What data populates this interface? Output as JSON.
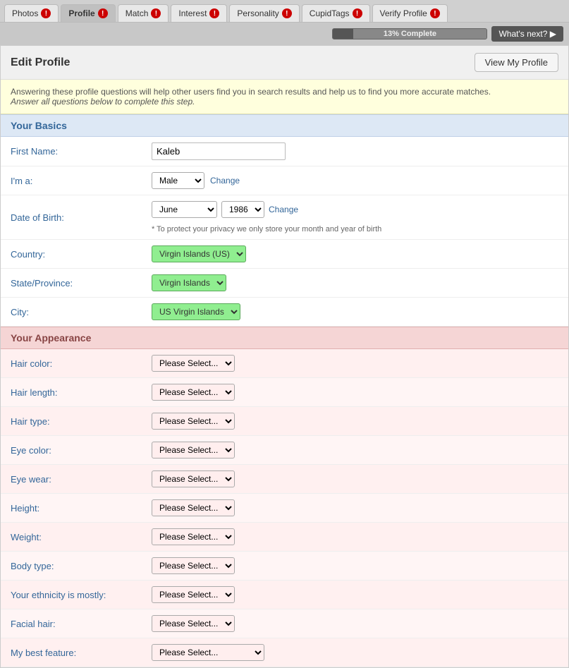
{
  "nav": {
    "tabs": [
      {
        "id": "photos",
        "label": "Photos",
        "badge": "!",
        "active": false
      },
      {
        "id": "profile",
        "label": "Profile",
        "badge": "!",
        "active": true
      },
      {
        "id": "match",
        "label": "Match",
        "badge": "!",
        "active": false
      },
      {
        "id": "interest",
        "label": "Interest",
        "badge": "!",
        "active": false
      },
      {
        "id": "personality",
        "label": "Personality",
        "badge": "!",
        "active": false
      },
      {
        "id": "cupidtags",
        "label": "CupidTags",
        "badge": "!",
        "active": false
      },
      {
        "id": "verifyprofile",
        "label": "Verify Profile",
        "badge": "!",
        "active": false
      }
    ]
  },
  "progress": {
    "percent": 13,
    "label": "13% Complete",
    "whats_next": "What's next? ▶"
  },
  "edit_profile": {
    "title": "Edit Profile",
    "view_profile_btn": "View My Profile"
  },
  "info_banner": {
    "line1": "Answering these profile questions will help other users find you in search results and help us to find you more accurate matches.",
    "line2": "Answer all questions below to complete this step."
  },
  "basics": {
    "section_title": "Your Basics",
    "fields": {
      "first_name": {
        "label": "First Name:",
        "value": "Kaleb"
      },
      "im_a": {
        "label": "I'm a:",
        "value": "Male",
        "change": "Change"
      },
      "dob": {
        "label": "Date of Birth:",
        "month": "June",
        "year": "1986",
        "change": "Change",
        "privacy_note": "* To protect your privacy we only store your month and year of birth"
      },
      "country": {
        "label": "Country:",
        "value": "Virgin Islands (US)"
      },
      "state": {
        "label": "State/Province:",
        "value": "Virgin Islands"
      },
      "city": {
        "label": "City:",
        "value": "US Virgin Islands"
      }
    }
  },
  "appearance": {
    "section_title": "Your Appearance",
    "fields": [
      {
        "label": "Hair color:",
        "value": "Please Select..."
      },
      {
        "label": "Hair length:",
        "value": "Please Select..."
      },
      {
        "label": "Hair type:",
        "value": "Please Select..."
      },
      {
        "label": "Eye color:",
        "value": "Please Select..."
      },
      {
        "label": "Eye wear:",
        "value": "Please Select..."
      },
      {
        "label": "Height:",
        "value": "Please Select..."
      },
      {
        "label": "Weight:",
        "value": "Please Select..."
      },
      {
        "label": "Body type:",
        "value": "Please Select..."
      },
      {
        "label": "Your ethnicity is mostly:",
        "value": "Please Select..."
      },
      {
        "label": "Facial hair:",
        "value": "Please Select..."
      },
      {
        "label": "My best feature:",
        "value": "Please Select..."
      }
    ]
  }
}
